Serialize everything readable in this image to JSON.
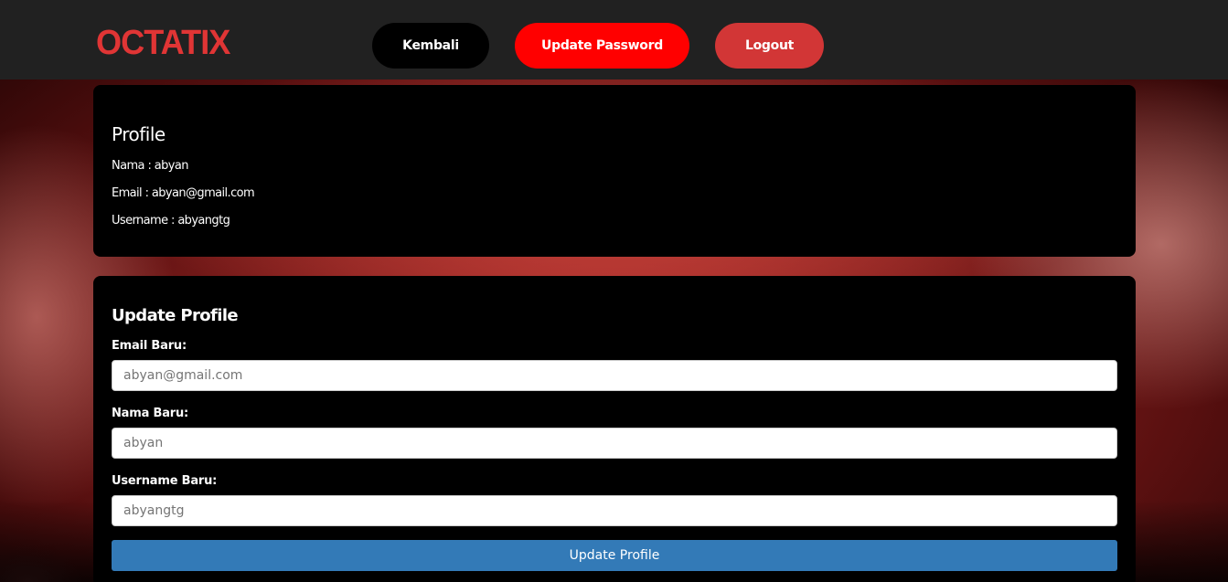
{
  "header": {
    "logo_text": "OCTATIX",
    "nav": {
      "back_label": "Kembali",
      "update_password_label": "Update Password",
      "logout_label": "Logout"
    }
  },
  "profile": {
    "title": "Profile",
    "nama_line": "Nama : abyan",
    "email_line": "Email : abyan@gmail.com",
    "username_line": "Username : abyangtg"
  },
  "update_form": {
    "title": "Update Profile",
    "email_label": "Email Baru:",
    "email_placeholder": "abyan@gmail.com",
    "nama_label": "Nama Baru:",
    "nama_placeholder": "abyan",
    "username_label": "Username Baru:",
    "username_placeholder": "abyangtg",
    "submit_label": "Update Profile"
  },
  "colors": {
    "brand_red": "#e03535",
    "topbar": "#212121",
    "update_password_button": "#ff0000",
    "logout_button": "#d23636",
    "submit_button": "#337ab7"
  }
}
